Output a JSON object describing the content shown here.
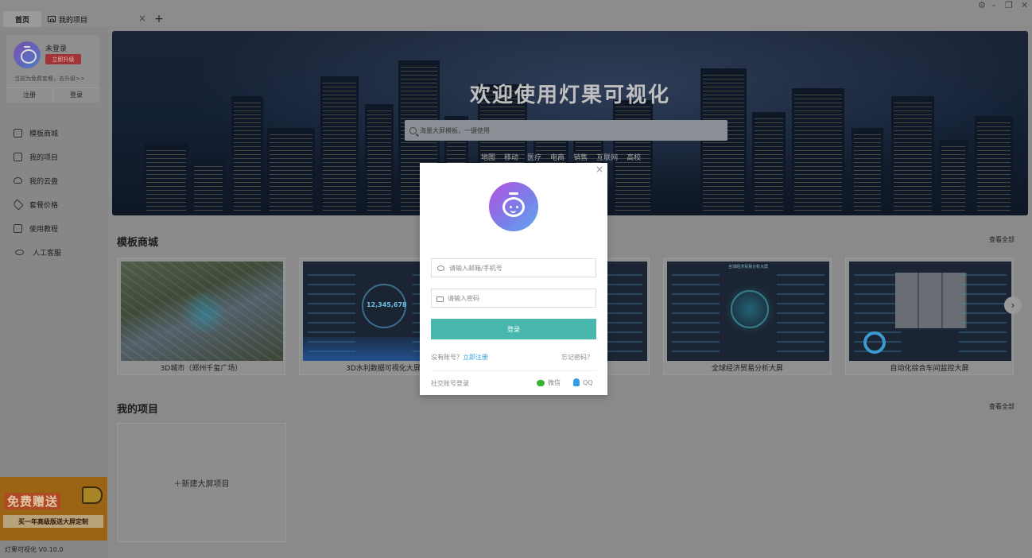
{
  "tabs": {
    "home": "首页",
    "project": "我的项目",
    "close": "×",
    "add": "+"
  },
  "window_controls": {
    "settings": "⚙",
    "minimize": "–",
    "restore": "❐",
    "close": "✕"
  },
  "user": {
    "status": "未登录",
    "upgrade": "立即升级",
    "hint": "当前为免费套餐，去升级>>",
    "register": "注册",
    "login": "登录"
  },
  "nav": [
    {
      "label": "模板商城",
      "icon": "template-icon"
    },
    {
      "label": "我的项目",
      "icon": "chart-icon"
    },
    {
      "label": "我的云盘",
      "icon": "cloud-icon"
    },
    {
      "label": "套餐价格",
      "icon": "tag-icon"
    },
    {
      "label": "使用教程",
      "icon": "book-icon"
    },
    {
      "label": "人工客服",
      "icon": "person-icon"
    }
  ],
  "promo": {
    "title": "免费赠送",
    "bar": "买一年高级版送大屏定制"
  },
  "version": "灯果可视化 V0.10.0",
  "banner": {
    "title": "欢迎使用灯果可视化",
    "search_placeholder": "海量大屏模板，一键使用",
    "tags": [
      "地图",
      "移动",
      "医疗",
      "电商",
      "销售",
      "互联网",
      "高校"
    ]
  },
  "templates": {
    "heading": "模板商城",
    "see_all": "查看全部",
    "cards": [
      {
        "title": "3D城市（郑州千玺广场）"
      },
      {
        "title": "3D水利数据可视化大屏"
      },
      {
        "title": ""
      },
      {
        "title": "全球经济贸易分析大屏"
      },
      {
        "title": "自动化综合车间监控大屏"
      }
    ],
    "card2_number": "12,345,678",
    "card4_header": "全球经济贸易分析大屏",
    "next": "›"
  },
  "projects": {
    "heading": "我的项目",
    "see_all": "查看全部",
    "new_label": "＋新建大屏项目"
  },
  "login_modal": {
    "close": "×",
    "account_placeholder": "请输入邮箱/手机号",
    "password_placeholder": "请输入密码",
    "login_button": "登录",
    "no_account": "没有账号？",
    "register_link": "立即注册",
    "forgot": "忘记密码？",
    "social_label": "社交账号登录",
    "wechat": "微信",
    "qq": "QQ"
  },
  "colors": {
    "login_button": "#48b7ad",
    "register_link": "#3a9ee0",
    "upgrade_badge": "#a13535"
  }
}
